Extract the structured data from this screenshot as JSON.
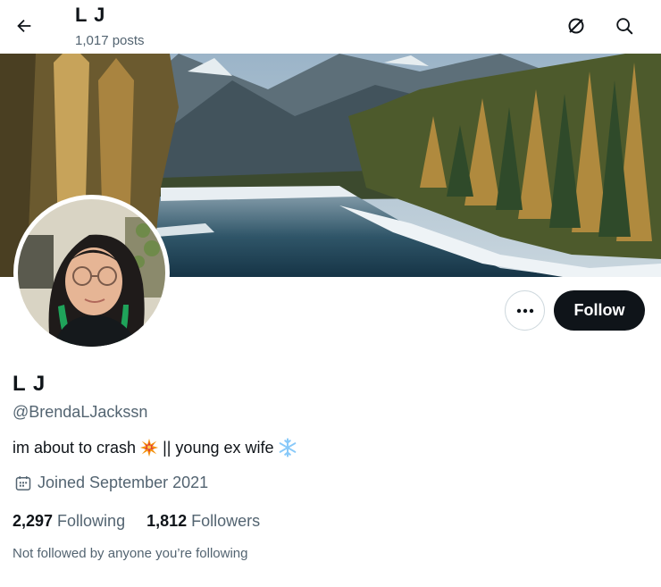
{
  "header": {
    "name": "L J",
    "post_count": "1,017 posts"
  },
  "icons": {
    "back": "arrow-left-icon",
    "crash": "circle-slash-icon",
    "search": "search-icon",
    "more": "ellipsis-icon",
    "calendar": "calendar-icon"
  },
  "actions": {
    "follow_label": "Follow"
  },
  "profile": {
    "display_name": "L J",
    "handle": "@BrendaLJackssn",
    "bio_part1": "im about to crash",
    "bio_part2": "|| young ex wife",
    "bio_emoji1": "collision-emoji",
    "bio_emoji2": "snowflake-emoji",
    "joined": "Joined September 2021",
    "following_count": "2,297",
    "following_label": "Following",
    "followers_count": "1,812",
    "followers_label": "Followers",
    "not_followed": "Not followed by anyone you’re following"
  },
  "colors": {
    "text_primary": "#0f1419",
    "text_secondary": "#536471",
    "border": "#cfd9de",
    "button_dark": "#0f1419"
  }
}
